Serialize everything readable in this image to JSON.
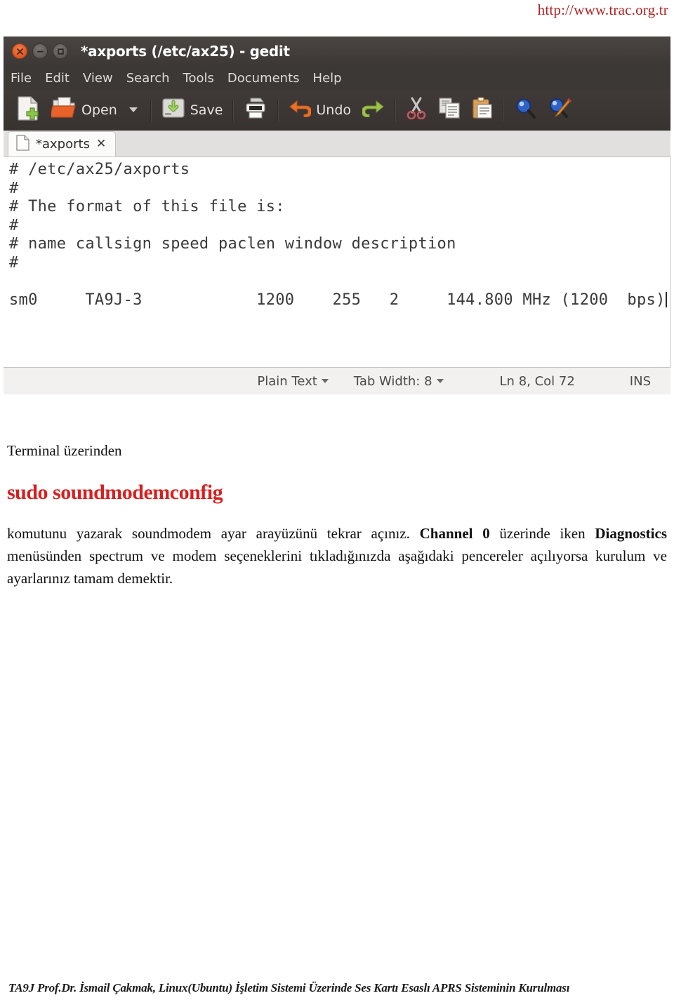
{
  "header": {
    "url": "http://www.trac.org.tr"
  },
  "gedit": {
    "window_title": "*axports (/etc/ax25) - gedit",
    "window_buttons": [
      {
        "name": "close",
        "icon": "close-icon"
      },
      {
        "name": "minimize",
        "icon": "minimize-icon"
      },
      {
        "name": "maximize",
        "icon": "maximize-icon"
      }
    ],
    "menubar": [
      "File",
      "Edit",
      "View",
      "Search",
      "Tools",
      "Documents",
      "Help"
    ],
    "toolbar": [
      {
        "icon": "new-document-icon",
        "label": ""
      },
      {
        "icon": "open-folder-icon",
        "label": "Open"
      },
      {
        "icon": "save-icon",
        "label": "Save"
      },
      {
        "icon": "print-icon",
        "label": ""
      },
      {
        "icon": "undo-icon",
        "label": "Undo"
      },
      {
        "icon": "redo-icon",
        "label": ""
      },
      {
        "icon": "cut-icon",
        "label": ""
      },
      {
        "icon": "copy-icon",
        "label": ""
      },
      {
        "icon": "paste-icon",
        "label": ""
      },
      {
        "icon": "find-icon",
        "label": ""
      },
      {
        "icon": "find-replace-icon",
        "label": ""
      }
    ],
    "tab": {
      "title": "*axports",
      "close_label": "✕",
      "icon": "document-icon"
    },
    "editor": {
      "content": "# /etc/ax25/axports\n#\n# The format of this file is:\n#\n# name callsign speed paclen window description\n#\n\nsm0     TA9J-3            1200    255   2     144.800 MHz (1200  bps)"
    },
    "statusbar": {
      "language": "Plain Text",
      "tab_width": "Tab Width: 8",
      "position": "Ln 8, Col 72",
      "insert_mode": "INS"
    }
  },
  "doc": {
    "lead_paragraph": "Terminal üzerinden",
    "command": "sudo soundmodemconfig",
    "body_parts": {
      "p1": "komutunu yazarak soundmodem ayar arayüzünü tekrar açınız. ",
      "b1": "Channel 0",
      "p2": " üzerinde iken ",
      "b2": "Diagnostics",
      "p3": " menüsünden spectrum ve modem seçeneklerini tıkladığınızda aşağıdaki pencereler açılıyorsa kurulum ve ayarlarınız tamam demektir."
    }
  },
  "footer": {
    "text": "TA9J Prof.Dr. İsmail Çakmak,  Linux(Ubuntu) İşletim Sistemi Üzerinde Ses Kartı Esaslı APRS Sisteminin Kurulması"
  },
  "colors": {
    "accent_red": "#d81f1f",
    "url_red": "#b02020",
    "titlebar_dark": "#3c3836",
    "close_orange": "#e0561f"
  }
}
